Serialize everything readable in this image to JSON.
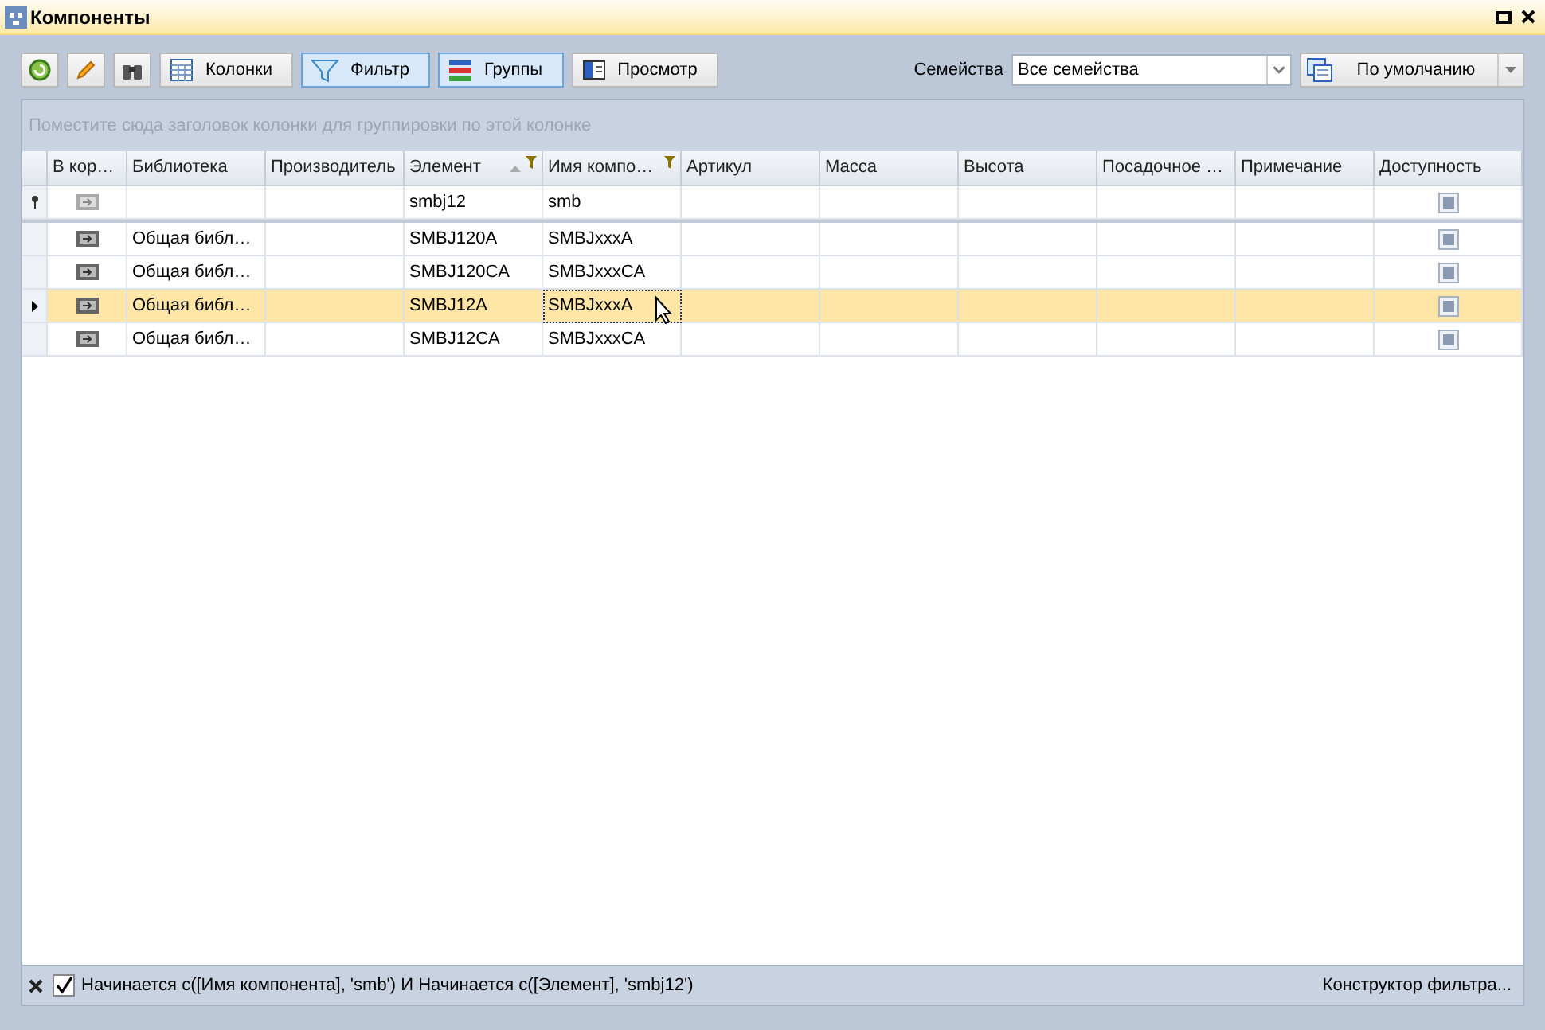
{
  "window": {
    "title": "Компоненты"
  },
  "toolbar": {
    "buttons": [
      {
        "kind": "refresh",
        "selected": false
      },
      {
        "kind": "edit",
        "selected": false
      },
      {
        "kind": "find",
        "selected": false
      },
      {
        "kind": "columns",
        "label": "Колонки",
        "selected": false
      },
      {
        "kind": "filter",
        "label": "Фильтр",
        "selected": true
      },
      {
        "kind": "groups",
        "label": "Группы",
        "selected": true
      },
      {
        "kind": "preview",
        "label": "Просмотр",
        "selected": false
      }
    ],
    "families_label": "Семейства",
    "families_value": "Все семейства",
    "layout_button": "По умолчанию"
  },
  "group_panel_hint": "Поместите сюда заголовок колонки для группировки по этой колонке",
  "table": {
    "columns": [
      {
        "label": "В кор…"
      },
      {
        "label": "Библиотека"
      },
      {
        "label": "Производитель"
      },
      {
        "label": "Элемент",
        "sorted_ascending": true,
        "filtered": true
      },
      {
        "label": "Имя компо…",
        "filtered": true
      },
      {
        "label": "Артикул"
      },
      {
        "label": "Масса"
      },
      {
        "label": "Высота"
      },
      {
        "label": "Посадочное …"
      },
      {
        "label": "Примечание"
      },
      {
        "label": "Доступность"
      }
    ],
    "filter_row": {
      "element": "smbj12",
      "name": "smb"
    },
    "rows": [
      {
        "library": "Общая библ…",
        "element": "SMBJ120A",
        "name": "SMBJxxxA",
        "selected": false
      },
      {
        "library": "Общая библ…",
        "element": "SMBJ120CA",
        "name": "SMBJxxxCA",
        "selected": false
      },
      {
        "library": "Общая библ…",
        "element": "SMBJ12A",
        "name": "SMBJxxxA",
        "selected": true
      },
      {
        "library": "Общая библ…",
        "element": "SMBJ12CA",
        "name": "SMBJxxxCA",
        "selected": false
      }
    ]
  },
  "filter_bar": {
    "enabled": true,
    "expression": "Начинается с([Имя компонента], 'smb') И Начинается с([Элемент], 'smbj12')",
    "editor_link": "Конструктор фильтра..."
  }
}
